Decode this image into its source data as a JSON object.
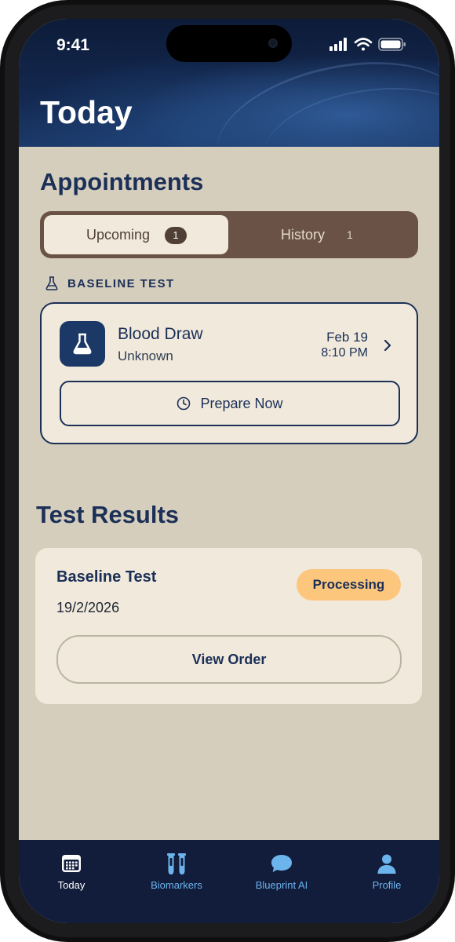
{
  "status_bar": {
    "time": "9:41"
  },
  "header": {
    "title": "Today"
  },
  "appointments": {
    "section_title": "Appointments",
    "tabs": [
      {
        "label": "Upcoming",
        "count": "1",
        "selected": true
      },
      {
        "label": "History",
        "count": "1",
        "selected": false
      }
    ],
    "category": {
      "icon": "flask-icon",
      "label": "BASELINE TEST"
    },
    "card": {
      "icon": "flask-icon",
      "title": "Blood Draw",
      "subtitle": "Unknown",
      "date": "Feb 19",
      "time": "8:10 PM",
      "prepare_label": "Prepare Now"
    }
  },
  "test_results": {
    "section_title": "Test Results",
    "card": {
      "title": "Baseline Test",
      "date": "19/2/2026",
      "status": "Processing",
      "button_label": "View Order"
    }
  },
  "tab_bar": {
    "items": [
      {
        "label": "Today",
        "icon": "calendar-icon",
        "active": true
      },
      {
        "label": "Biomarkers",
        "icon": "test-tubes-icon",
        "active": false
      },
      {
        "label": "Blueprint AI",
        "icon": "chat-bubble-icon",
        "active": false
      },
      {
        "label": "Profile",
        "icon": "person-icon",
        "active": false
      }
    ]
  },
  "colors": {
    "navy": "#1b2f57",
    "card_bg": "#f1eadc",
    "page_bg": "#d6cebd",
    "segment_bg": "#6a5346",
    "status_pill": "#fcc77d",
    "tab_active": "#ffffff",
    "tab_inactive": "#6cb4ec"
  }
}
